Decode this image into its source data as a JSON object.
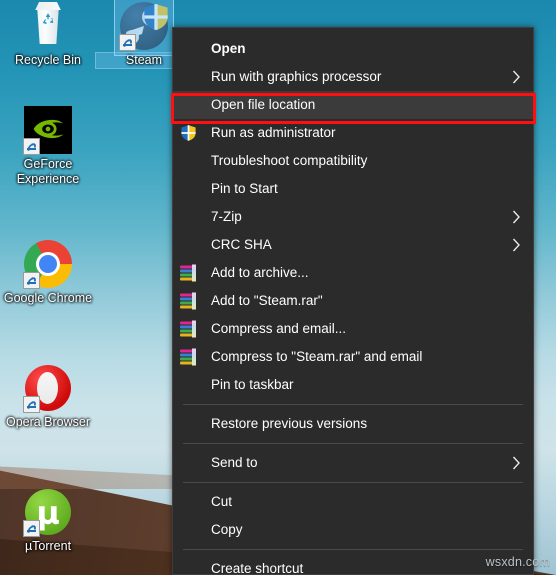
{
  "desktop": {
    "icons": [
      {
        "label": "Recycle Bin",
        "name": "recycle-bin",
        "selected": false
      },
      {
        "label": "Steam",
        "name": "steam",
        "selected": true
      },
      {
        "label": "GeForce Experience",
        "name": "geforce-experience",
        "selected": false
      },
      {
        "label": "Google Chrome",
        "name": "google-chrome",
        "selected": false
      },
      {
        "label": "Opera Browser",
        "name": "opera-browser",
        "selected": false
      },
      {
        "label": "µTorrent",
        "name": "utorrent",
        "selected": false
      }
    ]
  },
  "context_menu": {
    "target_file": "Steam.rar",
    "highlighted_item": "Open file location",
    "items": [
      {
        "label": "Open",
        "bold": true,
        "icon": "none",
        "submenu": false
      },
      {
        "label": "Run with graphics processor",
        "bold": false,
        "icon": "none",
        "submenu": true
      },
      {
        "label": "Open file location",
        "bold": false,
        "icon": "none",
        "submenu": false
      },
      {
        "label": "Run as administrator",
        "bold": false,
        "icon": "shield",
        "submenu": false
      },
      {
        "label": "Troubleshoot compatibility",
        "bold": false,
        "icon": "none",
        "submenu": false
      },
      {
        "label": "Pin to Start",
        "bold": false,
        "icon": "none",
        "submenu": false
      },
      {
        "label": "7-Zip",
        "bold": false,
        "icon": "none",
        "submenu": true
      },
      {
        "label": "CRC SHA",
        "bold": false,
        "icon": "none",
        "submenu": true
      },
      {
        "label": "Add to archive...",
        "bold": false,
        "icon": "winrar",
        "submenu": false
      },
      {
        "label": "Add to \"Steam.rar\"",
        "bold": false,
        "icon": "winrar",
        "submenu": false
      },
      {
        "label": "Compress and email...",
        "bold": false,
        "icon": "winrar",
        "submenu": false
      },
      {
        "label": "Compress to \"Steam.rar\" and email",
        "bold": false,
        "icon": "winrar",
        "submenu": false
      },
      {
        "label": "Pin to taskbar",
        "bold": false,
        "icon": "none",
        "submenu": false
      },
      {
        "label": "Restore previous versions",
        "bold": false,
        "icon": "none",
        "submenu": false
      },
      {
        "label": "Send to",
        "bold": false,
        "icon": "none",
        "submenu": true
      },
      {
        "label": "Cut",
        "bold": false,
        "icon": "none",
        "submenu": false
      },
      {
        "label": "Copy",
        "bold": false,
        "icon": "none",
        "submenu": false
      },
      {
        "label": "Create shortcut",
        "bold": false,
        "icon": "none",
        "submenu": false
      }
    ],
    "separator_after_indices": [
      12,
      13,
      14,
      16
    ]
  },
  "annotation": {
    "highlight_color": "#ff0f0f",
    "highlight_target": "Open file location"
  },
  "watermark": {
    "text": "wsxdn.com"
  },
  "colors": {
    "menu_background": "#2b2b2b",
    "menu_highlight": "#3b3b3b",
    "menu_text": "#ffffff",
    "separator": "#4a4a4a",
    "desktop_top": "#1b88ad",
    "desktop_sand": "#52331f",
    "selection": "#6ebeeb"
  }
}
